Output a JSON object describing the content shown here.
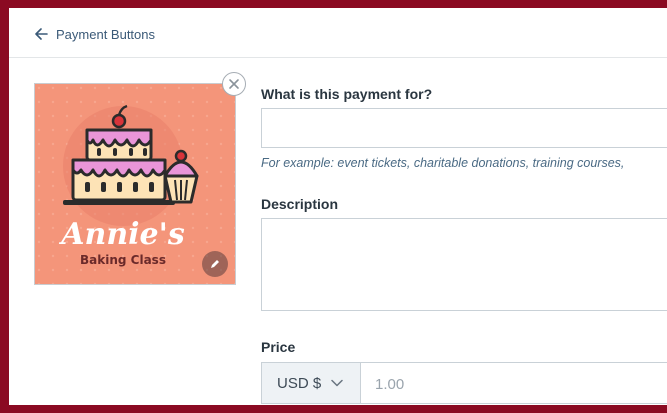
{
  "header": {
    "back_label": "Payment Buttons"
  },
  "image": {
    "title": "Annie's",
    "subtitle": "Baking Class",
    "background_color": "#f4957a"
  },
  "form": {
    "product_label": "What is this payment for?",
    "product_value": "",
    "product_hint": "For example: event tickets, charitable donations, training courses,",
    "description_label": "Description",
    "description_value": "",
    "price_label": "Price",
    "currency_label": "USD $",
    "price_placeholder": "1.00"
  },
  "icons": {
    "back": "arrow-left-icon",
    "remove": "close-icon",
    "edit": "pencil-icon",
    "dropdown": "chevron-down-icon"
  }
}
